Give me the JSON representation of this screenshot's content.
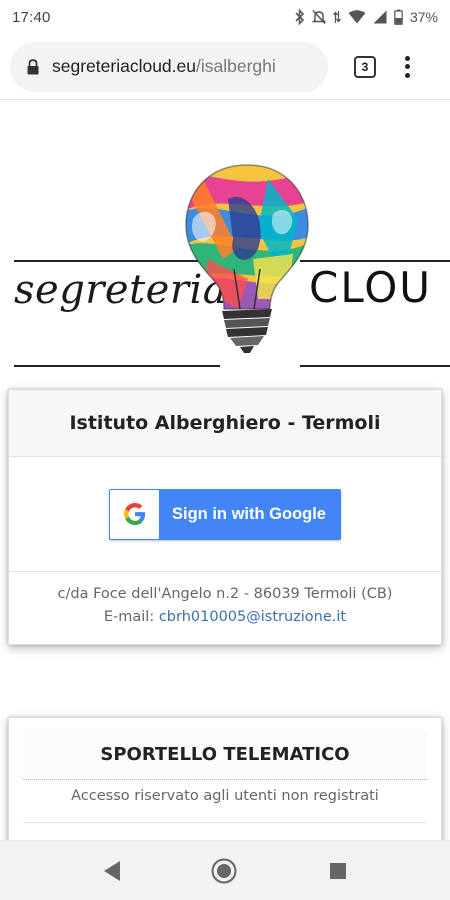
{
  "status_bar": {
    "time": "17:40",
    "battery": "37%",
    "icons": [
      "bluetooth-icon",
      "notifications-off-icon",
      "data-arrows-icon",
      "wifi-icon",
      "signal-icon",
      "battery-icon"
    ]
  },
  "browser": {
    "url_domain": "segreteriacloud.eu",
    "url_path": "/isalberghi",
    "tab_count": "3"
  },
  "logo": {
    "script_text": "segreteria",
    "brand_text": "CLOU"
  },
  "login_card": {
    "title": "Istituto Alberghiero - Termoli",
    "google_button_label": "Sign in with Google",
    "address": "c/da Foce dell'Angelo n.2 - 86039 Termoli (CB)",
    "email_label": "E-mail:",
    "email": "cbrh010005@istruzione.it"
  },
  "sportello_card": {
    "title": "SPORTELLO TELEMATICO",
    "subtitle": "Accesso riservato agli utenti non registrati"
  },
  "colors": {
    "google_blue": "#4285f4",
    "link_blue": "#3a6fb0"
  }
}
